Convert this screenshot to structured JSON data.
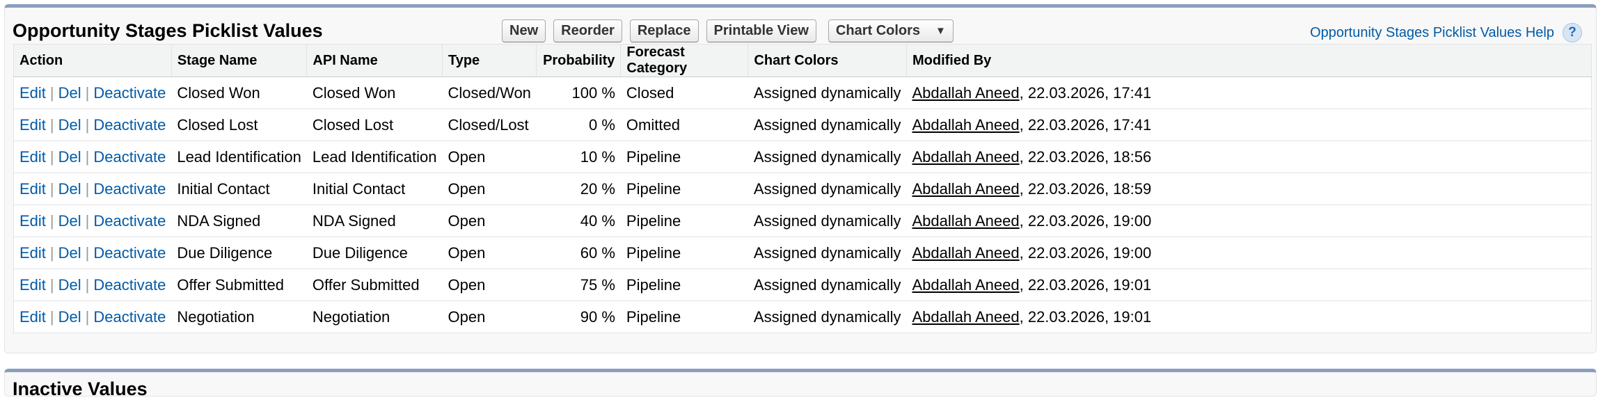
{
  "section": {
    "title": "Opportunity Stages Picklist Values",
    "buttons": {
      "new": "New",
      "reorder": "Reorder",
      "replace": "Replace",
      "printable_view": "Printable View",
      "chart_colors": "Chart Colors"
    },
    "help_link": "Opportunity Stages Picklist Values Help",
    "help_icon": "?"
  },
  "table": {
    "headers": [
      "Action",
      "Stage Name",
      "API Name",
      "Type",
      "Probability",
      "Forecast Category",
      "Chart Colors",
      "Modified By"
    ],
    "action_labels": {
      "edit": "Edit",
      "del": "Del",
      "deactivate": "Deactivate",
      "separator": "|"
    },
    "rows": [
      {
        "stage": "Closed Won",
        "api": "Closed Won",
        "type": "Closed/Won",
        "probability": "100 %",
        "forecast": "Closed",
        "colors": "Assigned dynamically",
        "user": "Abdallah Aneed",
        "date": ", 22.03.2026, 17:41"
      },
      {
        "stage": "Closed Lost",
        "api": "Closed Lost",
        "type": "Closed/Lost",
        "probability": "0 %",
        "forecast": "Omitted",
        "colors": "Assigned dynamically",
        "user": "Abdallah Aneed",
        "date": ", 22.03.2026, 17:41"
      },
      {
        "stage": "Lead Identification",
        "api": "Lead Identification",
        "type": "Open",
        "probability": "10 %",
        "forecast": "Pipeline",
        "colors": "Assigned dynamically",
        "user": "Abdallah Aneed",
        "date": ", 22.03.2026, 18:56"
      },
      {
        "stage": "Initial Contact",
        "api": "Initial Contact",
        "type": "Open",
        "probability": "20 %",
        "forecast": "Pipeline",
        "colors": "Assigned dynamically",
        "user": "Abdallah Aneed",
        "date": ", 22.03.2026, 18:59"
      },
      {
        "stage": "NDA Signed",
        "api": "NDA Signed",
        "type": "Open",
        "probability": "40 %",
        "forecast": "Pipeline",
        "colors": "Assigned dynamically",
        "user": "Abdallah Aneed",
        "date": ", 22.03.2026, 19:00"
      },
      {
        "stage": "Due Diligence",
        "api": "Due Diligence",
        "type": "Open",
        "probability": "60 %",
        "forecast": "Pipeline",
        "colors": "Assigned dynamically",
        "user": "Abdallah Aneed",
        "date": ", 22.03.2026, 19:00"
      },
      {
        "stage": "Offer Submitted",
        "api": "Offer Submitted",
        "type": "Open",
        "probability": "75 %",
        "forecast": "Pipeline",
        "colors": "Assigned dynamically",
        "user": "Abdallah Aneed",
        "date": ", 22.03.2026, 19:01"
      },
      {
        "stage": "Negotiation",
        "api": "Negotiation",
        "type": "Open",
        "probability": "90 %",
        "forecast": "Pipeline",
        "colors": "Assigned dynamically",
        "user": "Abdallah Aneed",
        "date": ", 22.03.2026, 19:01"
      }
    ]
  },
  "next_section": {
    "title": "Inactive Values"
  },
  "colors": {
    "link": "#015ba7",
    "panel_border": "#8a9ebe",
    "header_bg": "#f2f3f3"
  }
}
